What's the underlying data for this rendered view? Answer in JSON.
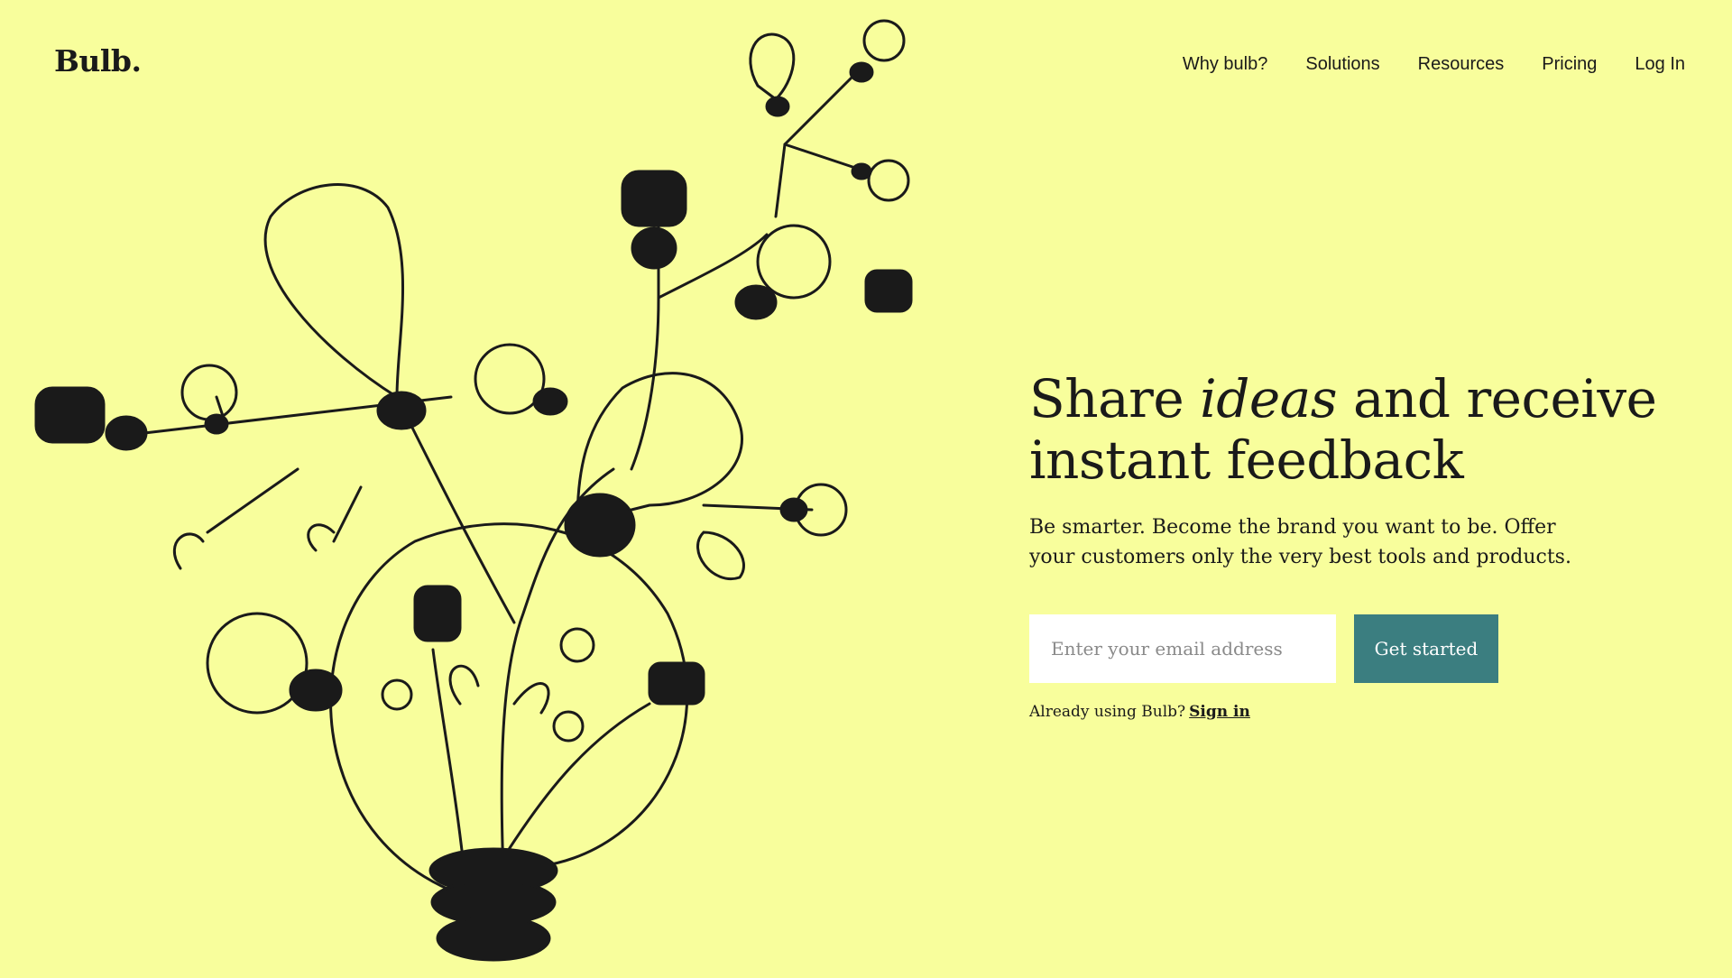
{
  "brand": {
    "logo": "Bulb."
  },
  "nav": [
    {
      "label": "Why bulb?"
    },
    {
      "label": "Solutions"
    },
    {
      "label": "Resources"
    },
    {
      "label": "Pricing"
    },
    {
      "label": "Log In"
    }
  ],
  "hero": {
    "headline_pre": "Share ",
    "headline_em": "ideas",
    "headline_post": " and receive instant feedback",
    "subtitle": "Be smarter. Become the brand you want to be. Offer your customers only the very best tools and products.",
    "email_placeholder": "Enter your email address",
    "cta_label": "Get started",
    "already_text": "Already using Bulb?",
    "signin_label": "Sign in"
  },
  "colors": {
    "background": "#f8fe9c",
    "accent": "#3b7e80",
    "ink": "#1a1a1a"
  },
  "illustration": {
    "icon": "lightbulb-tree-illustration"
  }
}
